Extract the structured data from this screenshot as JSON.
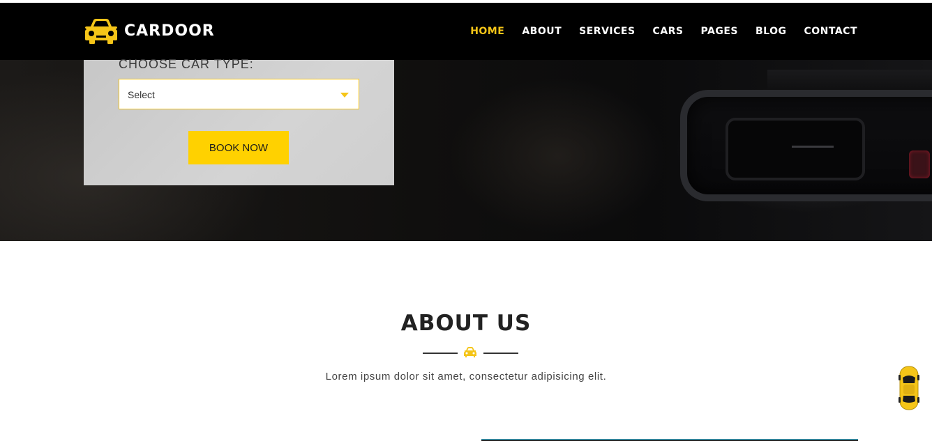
{
  "brand": {
    "name": "CARDOOR",
    "logo_icon": "car-front-icon"
  },
  "nav": {
    "items": [
      {
        "label": "HOME",
        "active": true
      },
      {
        "label": "ABOUT",
        "active": false
      },
      {
        "label": "SERVICES",
        "active": false
      },
      {
        "label": "CARS",
        "active": false
      },
      {
        "label": "PAGES",
        "active": false
      },
      {
        "label": "BLOG",
        "active": false
      },
      {
        "label": "CONTACT",
        "active": false
      }
    ]
  },
  "booking": {
    "choose_label": "CHOOSE CAR TYPE:",
    "select_value": "Select",
    "button_label": "BOOK NOW"
  },
  "about": {
    "title": "ABOUT US",
    "divider_icon": "car-front-icon",
    "subtitle": "Lorem ipsum dolor sit amet, consectetur adipisicing elit."
  },
  "scroll_top": {
    "icon": "car-topview-icon"
  },
  "colors": {
    "accent": "#f5c518",
    "button": "#ffd100",
    "header": "#000000",
    "text": "#222222"
  }
}
